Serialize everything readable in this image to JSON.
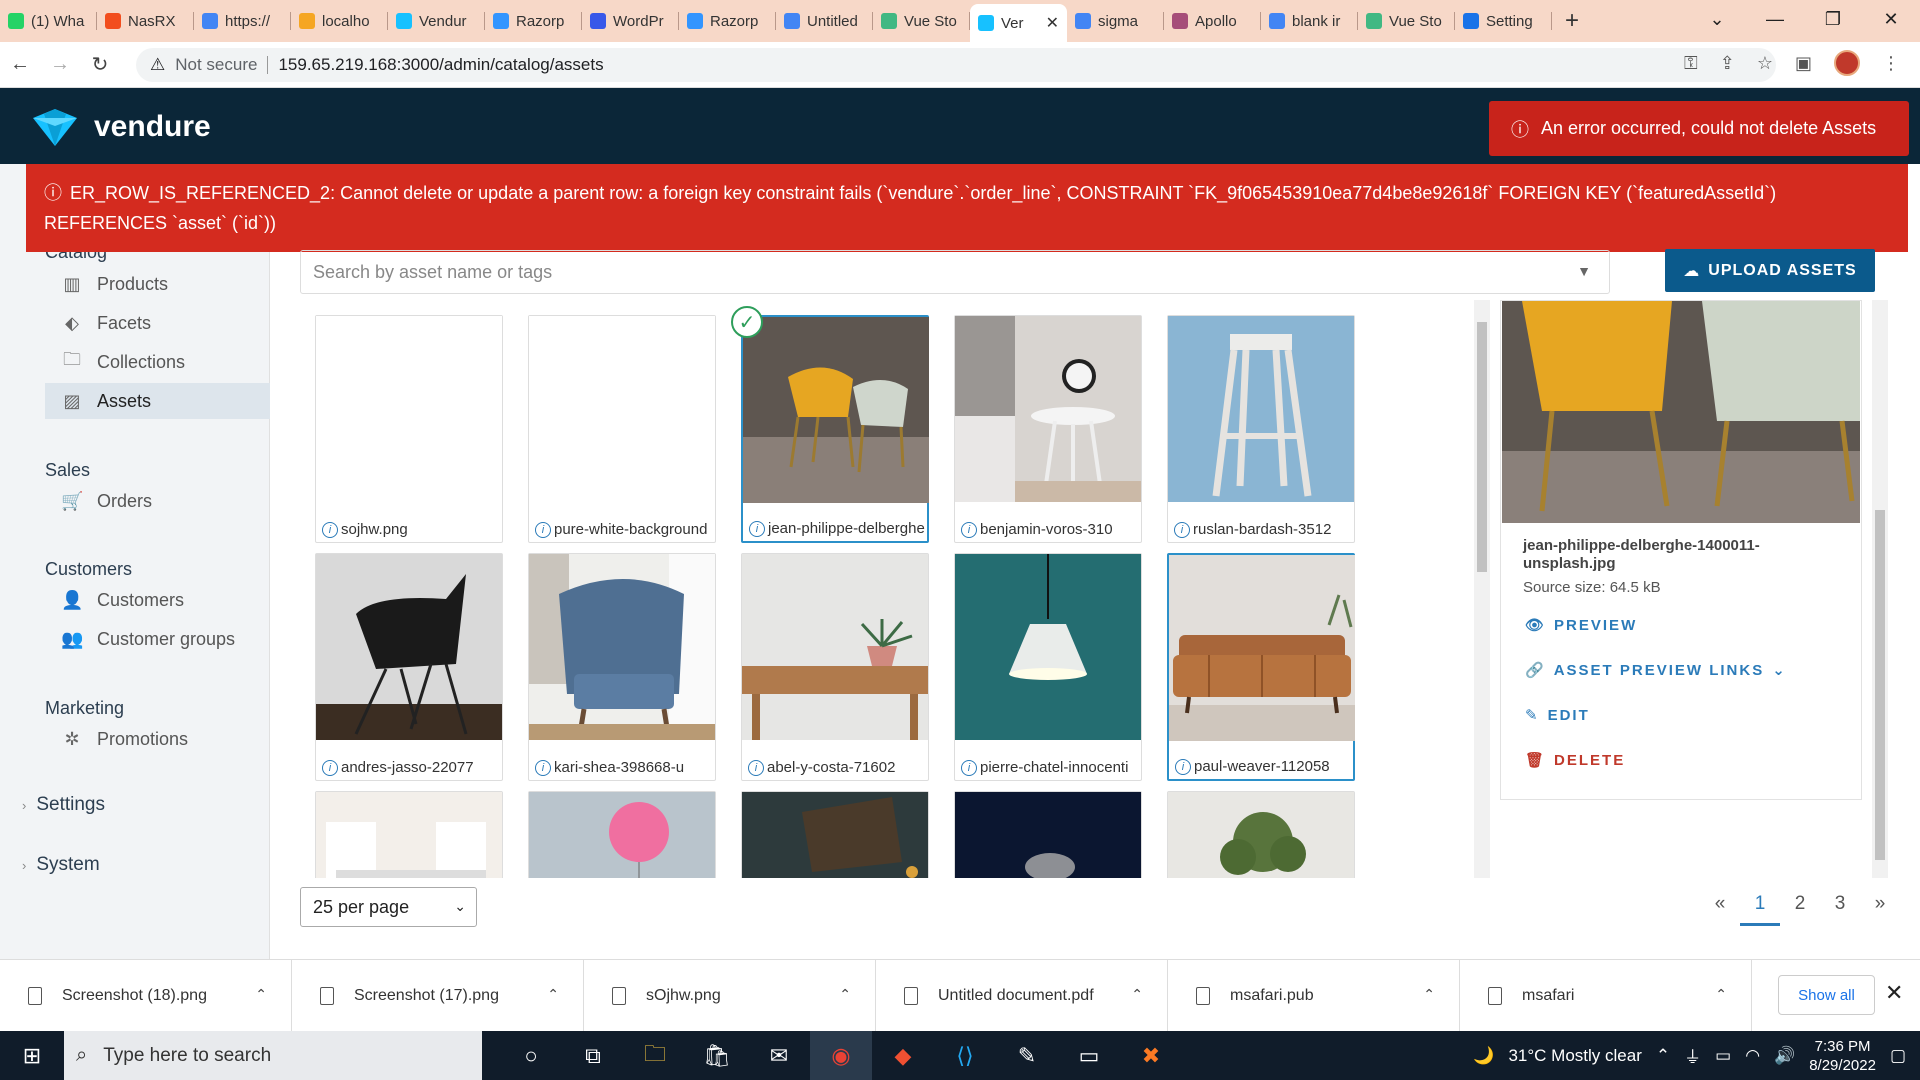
{
  "browser": {
    "tabs": [
      {
        "title": "(1) Wha",
        "color": "#25d366"
      },
      {
        "title": "NasRX",
        "color": "#f24e1e"
      },
      {
        "title": "https://",
        "color": "#4285f4"
      },
      {
        "title": "localho",
        "color": "#f5a623"
      },
      {
        "title": "Vendur",
        "color": "#17c1ff"
      },
      {
        "title": "Razorp",
        "color": "#3395ff"
      },
      {
        "title": "WordPr",
        "color": "#3858e9"
      },
      {
        "title": "Razorp",
        "color": "#3395ff"
      },
      {
        "title": "Untitled",
        "color": "#4285f4"
      },
      {
        "title": "Vue Sto",
        "color": "#41b883"
      },
      {
        "title": "Ver",
        "color": "#17c1ff",
        "active": true
      },
      {
        "title": "sigma",
        "color": "#4285f4"
      },
      {
        "title": "Apollo",
        "color": "#a64d79"
      },
      {
        "title": "blank ir",
        "color": "#4285f4"
      },
      {
        "title": "Vue Sto",
        "color": "#41b883"
      },
      {
        "title": "Setting",
        "color": "#1a73e8"
      }
    ],
    "not_secure": "Not secure",
    "url": "159.65.219.168:3000/admin/catalog/assets"
  },
  "app": {
    "brand": "vendure",
    "toast": "An error occurred, could not delete Assets",
    "error_banner": "ER_ROW_IS_REFERENCED_2: Cannot delete or update a parent row: a foreign key constraint fails (`vendure`.`order_line`, CONSTRAINT `FK_9f065453910ea77d4be8e92618f` FOREIGN KEY (`featuredAssetId`) REFERENCES `asset` (`id`))"
  },
  "sidebar": {
    "catalog": "Catalog",
    "catalog_items": [
      "Products",
      "Facets",
      "Collections",
      "Assets"
    ],
    "sales": "Sales",
    "sales_items": [
      "Orders"
    ],
    "customers": "Customers",
    "customers_items": [
      "Customers",
      "Customer groups"
    ],
    "marketing": "Marketing",
    "marketing_items": [
      "Promotions"
    ],
    "settings": "Settings",
    "system": "System"
  },
  "main": {
    "search_placeholder": "Search by asset name or tags",
    "upload_label": "UPLOAD ASSETS",
    "assets": [
      {
        "name": "sojhw.png"
      },
      {
        "name": "pure-white-background"
      },
      {
        "name": "jean-philippe-delberghe"
      },
      {
        "name": "benjamin-voros-310"
      },
      {
        "name": "ruslan-bardash-3512"
      },
      {
        "name": "andres-jasso-22077"
      },
      {
        "name": "kari-shea-398668-u"
      },
      {
        "name": "abel-y-costa-71602"
      },
      {
        "name": "pierre-chatel-innocenti"
      },
      {
        "name": "paul-weaver-112058"
      }
    ],
    "per_page": "25 per page",
    "pages": [
      "«",
      "1",
      "2",
      "3",
      "»"
    ]
  },
  "detail": {
    "filename": "jean-philippe-delberghe-1400011-unsplash.jpg",
    "source_size": "Source size: 64.5 kB",
    "preview": "PREVIEW",
    "links": "ASSET PREVIEW LINKS",
    "edit": "EDIT",
    "delete": "DELETE"
  },
  "downloads": {
    "items": [
      "Screenshot (18).png",
      "Screenshot (17).png",
      "sOjhw.png",
      "Untitled document.pdf",
      "msafari.pub",
      "msafari"
    ],
    "show_all": "Show all"
  },
  "taskbar": {
    "search_placeholder": "Type here to search",
    "weather": "31°C  Mostly clear",
    "time": "7:36 PM",
    "date": "8/29/2022"
  }
}
